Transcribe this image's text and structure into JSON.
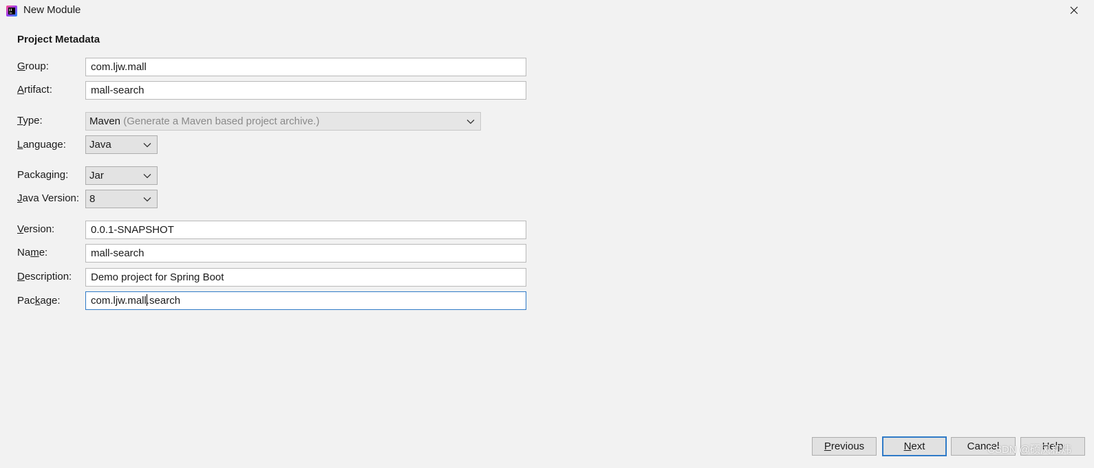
{
  "window": {
    "title": "New Module",
    "close_icon": "close-icon"
  },
  "section_title": "Project Metadata",
  "fields": {
    "group": {
      "label_mn": "G",
      "label_rest": "roup:",
      "value": "com.ljw.mall"
    },
    "artifact": {
      "label_mn": "A",
      "label_rest": "rtifact:",
      "value": "mall-search"
    },
    "type": {
      "label_mn": "T",
      "label_rest": "ype:",
      "value": "Maven",
      "hint": "(Generate a Maven based project archive.)"
    },
    "language": {
      "label_mn": "L",
      "label_rest": "anguage:",
      "value": "Java"
    },
    "packaging": {
      "label_pre": "Packa",
      "label_mn": "g",
      "label_rest": "ing:",
      "value": "Jar"
    },
    "java_version": {
      "label_mn": "J",
      "label_rest": "ava Version:",
      "value": "8"
    },
    "version": {
      "label_mn": "V",
      "label_rest": "ersion:",
      "value": "0.0.1-SNAPSHOT"
    },
    "name": {
      "label_pre": "Na",
      "label_mn": "m",
      "label_rest": "e:",
      "value": "mall-search"
    },
    "description": {
      "label_mn": "D",
      "label_rest": "escription:",
      "value": "Demo project for Spring Boot"
    },
    "package": {
      "label_pre": "Pac",
      "label_mn": "k",
      "label_rest": "age:",
      "value_before_caret": "com.ljw.mall",
      "value_after_caret": ".search"
    }
  },
  "buttons": {
    "previous": {
      "mn": "P",
      "rest": "revious"
    },
    "next": {
      "mn": "N",
      "rest": "ext"
    },
    "cancel": "Cancel",
    "help": "Help"
  },
  "watermark": "CSDN @硕风和炜",
  "colors": {
    "background": "#f2f2f2",
    "focus_border": "#2f7ac7",
    "hint_text": "#8a8a8a"
  }
}
